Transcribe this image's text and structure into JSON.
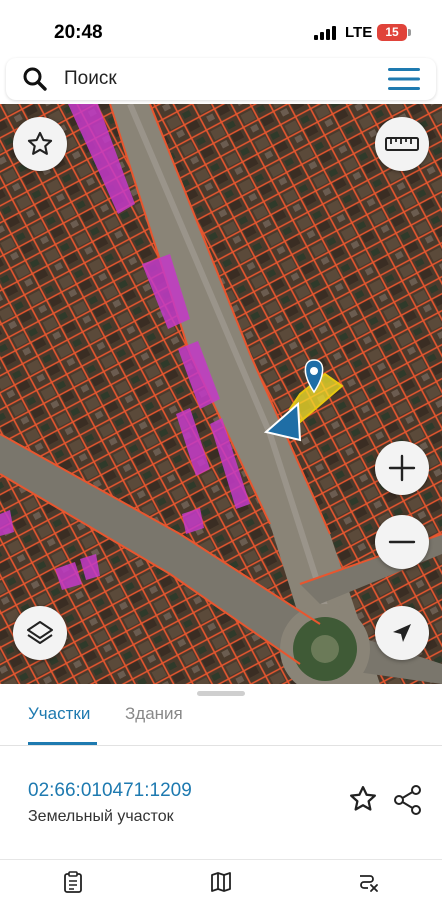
{
  "status_bar": {
    "time": "20:48",
    "network": "LTE",
    "battery": "15"
  },
  "search": {
    "placeholder": "Поиск",
    "icon": "search-icon",
    "menu_icon": "hamburger-menu-icon"
  },
  "map": {
    "controls": {
      "favorites": "star-icon",
      "ruler": "ruler-icon",
      "layers": "layers-icon",
      "zoom_in": "plus-icon",
      "zoom_out": "minus-icon",
      "locate": "navigation-arrow-icon"
    },
    "colors": {
      "parcel_border": "#e8562f",
      "building_fill": "#c43ac8",
      "selected_parcel": "#f4e22a",
      "pin": "#1f6ea6"
    }
  },
  "sheet": {
    "tabs": [
      {
        "label": "Участки",
        "active": true
      },
      {
        "label": "Здания",
        "active": false
      }
    ],
    "parcel": {
      "cadastral_number": "02:66:010471:1209",
      "type": "Земельный участок"
    },
    "accent": "#1e7ab0"
  },
  "bottom_nav": [
    "clipboard-icon",
    "map-icon",
    "route-icon"
  ]
}
